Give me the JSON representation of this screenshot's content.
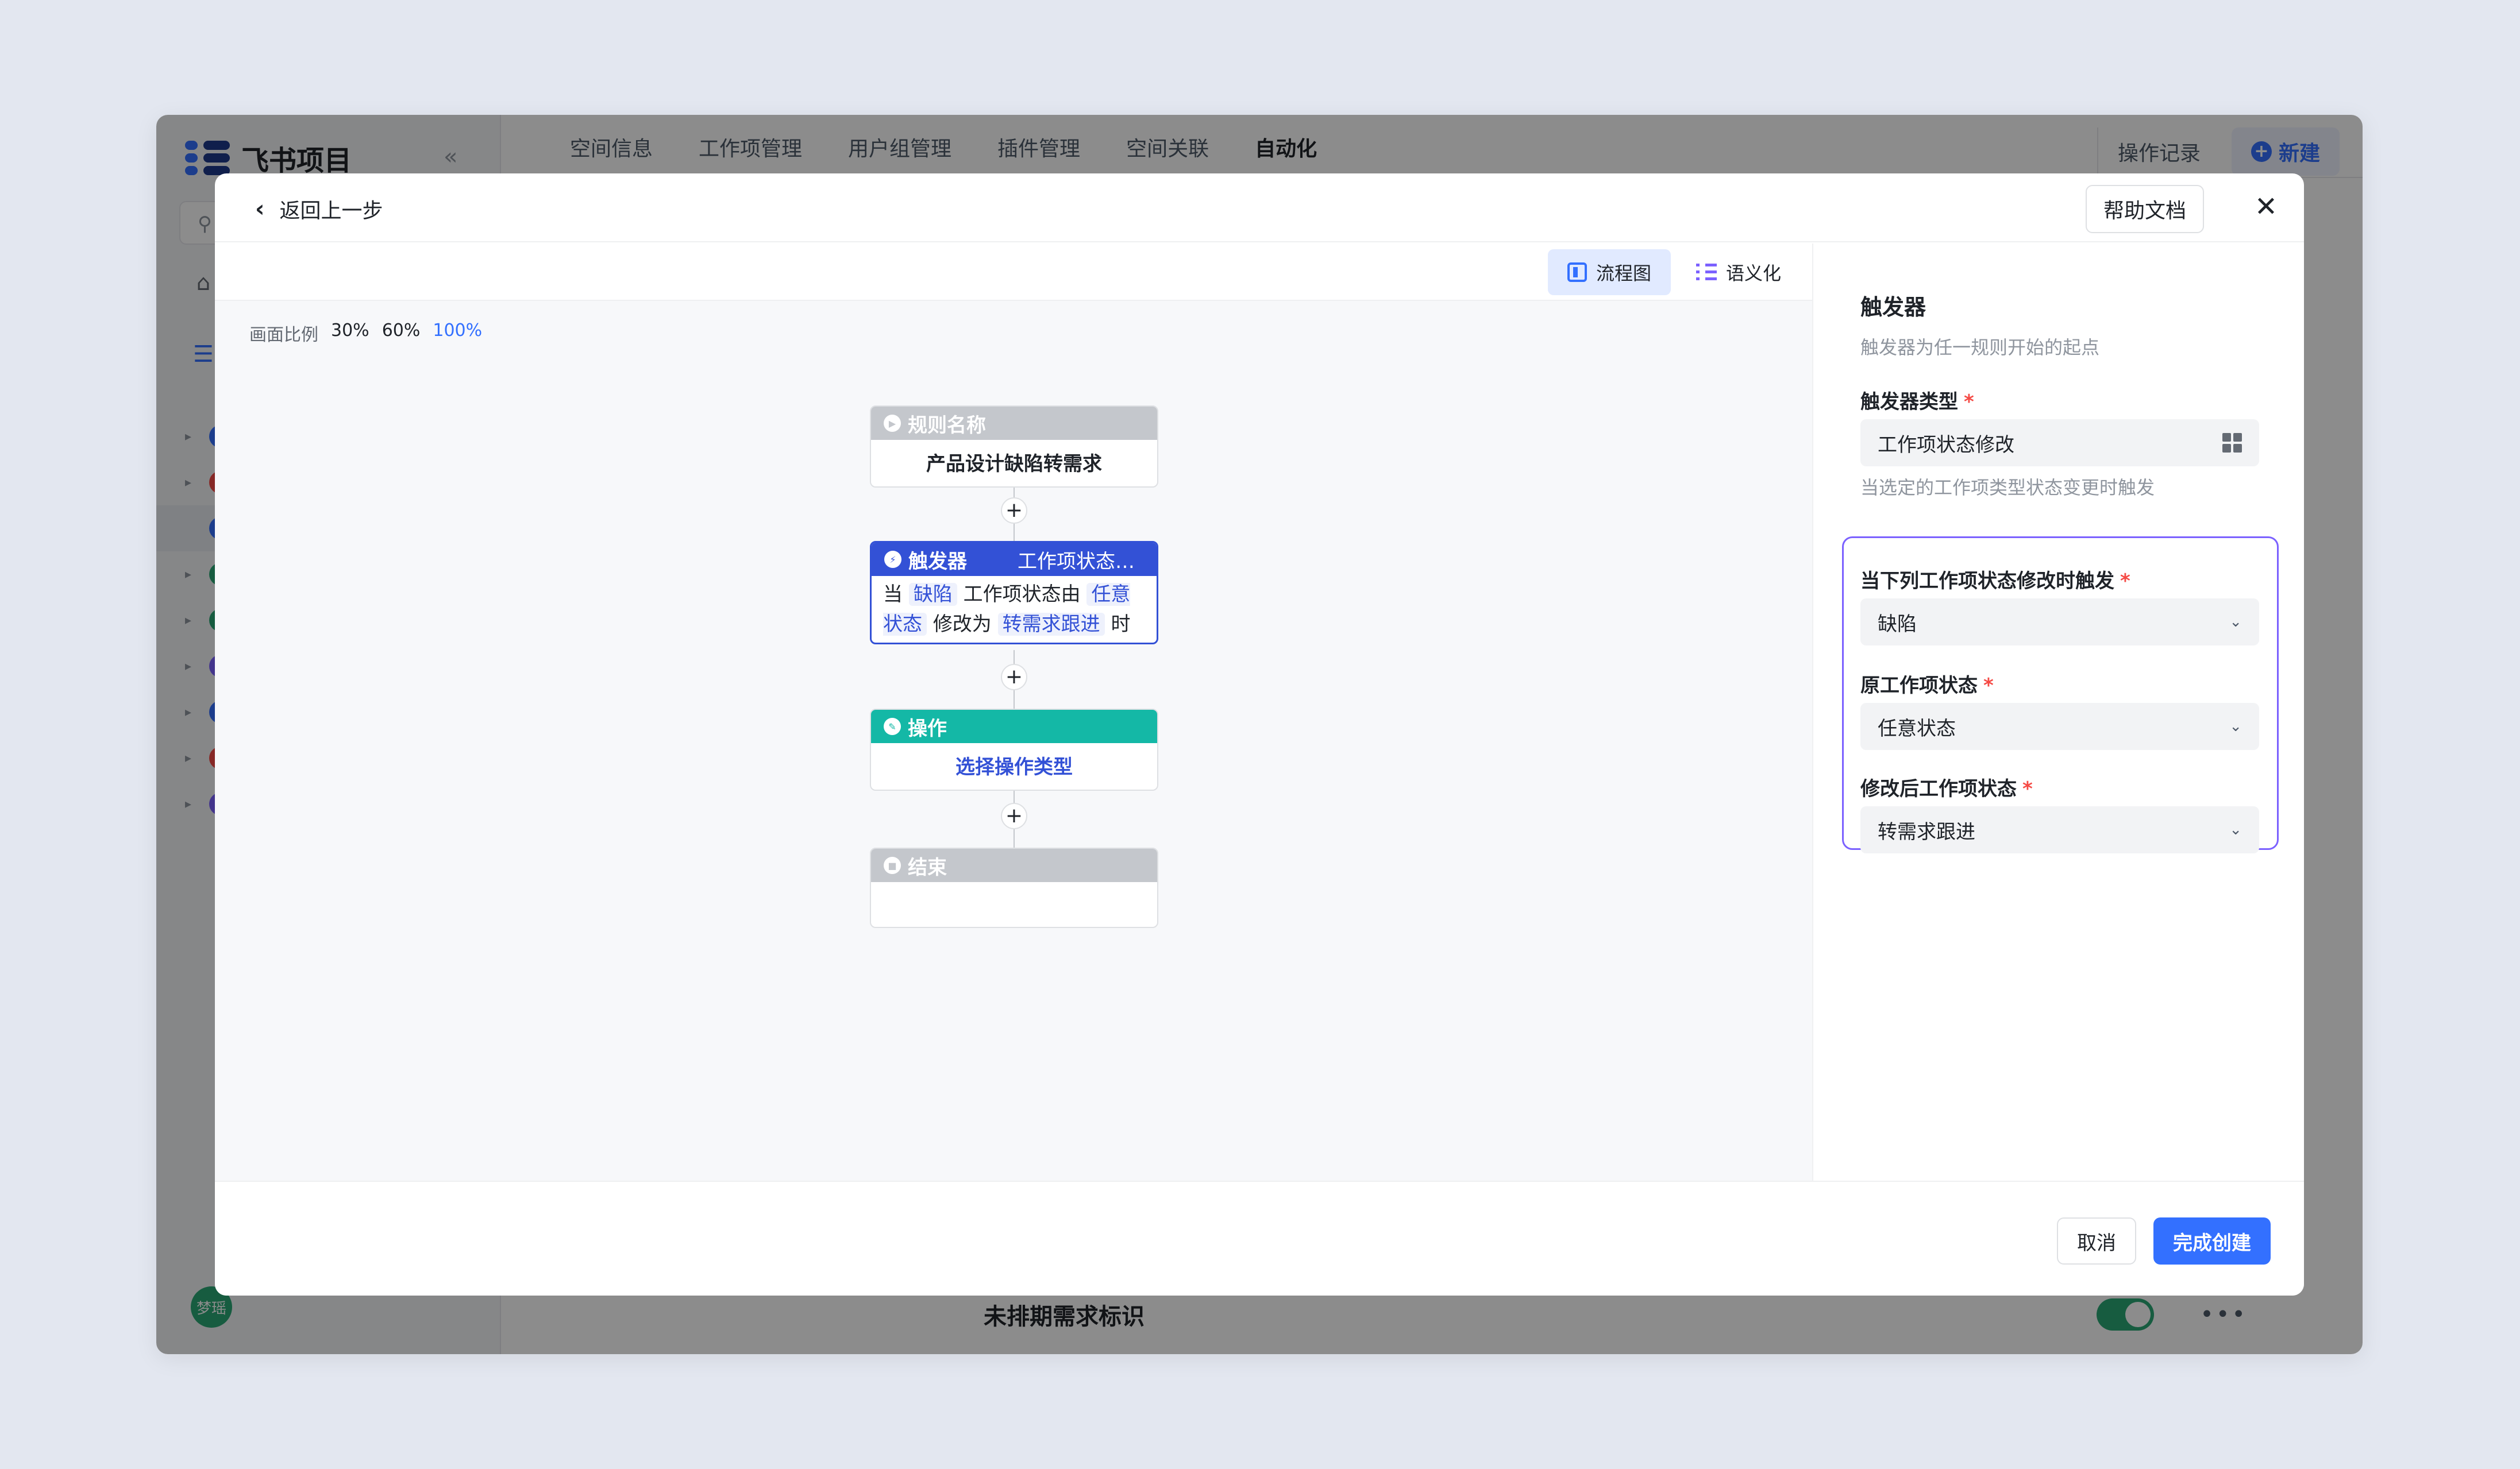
{
  "app": {
    "name": "飞书项目",
    "user_avatar": "梦瑶",
    "nav_tabs": [
      "空间信息",
      "工作项管理",
      "用户组管理",
      "插件管理",
      "空间关联",
      "自动化"
    ],
    "active_tab": "自动化",
    "op_log_label": "操作记录",
    "new_label": "新建",
    "bg_row_title": "未排期需求标识"
  },
  "modal": {
    "back_label": "返回上一步",
    "help_label": "帮助文档",
    "views": {
      "flow": "流程图",
      "semantic": "语义化"
    },
    "zoom": {
      "label": "画面比例",
      "options": [
        "30%",
        "60%",
        "100%"
      ],
      "active": "100%"
    },
    "nodes": {
      "rule": {
        "title": "规则名称",
        "content": "产品设计缺陷转需求"
      },
      "trigger": {
        "title": "触发器",
        "subtitle": "工作项状态修改",
        "sentence": {
          "p1": "当",
          "item_type": "缺陷",
          "p2": "工作项状态由",
          "from_state": "任意状态",
          "p3": "修改为",
          "to_state": "转需求跟进",
          "p4": "时"
        }
      },
      "action": {
        "title": "操作",
        "content": "选择操作类型"
      },
      "end": {
        "title": "结束"
      }
    },
    "panel": {
      "title": "触发器",
      "description": "触发器为任一规则开始的起点",
      "trigger_type_label": "触发器类型",
      "trigger_type_value": "工作项状态修改",
      "trigger_type_hint": "当选定的工作项类型状态变更时触发",
      "item_type_label": "当下列工作项状态修改时触发",
      "item_type_value": "缺陷",
      "from_state_label": "原工作项状态",
      "from_state_value": "任意状态",
      "to_state_label": "修改后工作项状态",
      "to_state_value": "转需求跟进"
    },
    "footer": {
      "cancel_label": "取消",
      "create_label": "完成创建"
    }
  },
  "colors": {
    "primary": "#3370ff",
    "trigger": "#3351d6",
    "action": "#14b8a6",
    "muted_node": "#c4c7cc",
    "focus_border": "#7b61ff"
  }
}
